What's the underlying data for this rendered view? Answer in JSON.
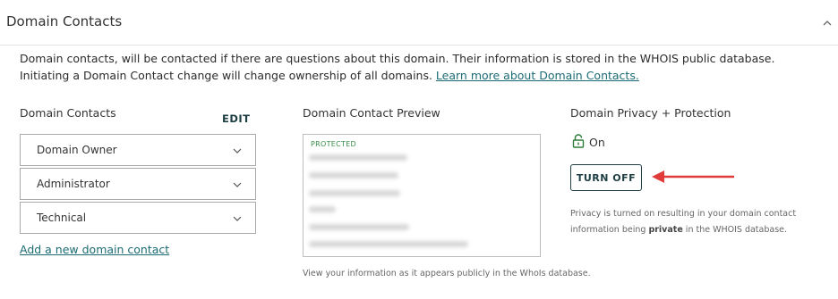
{
  "header": {
    "title": "Domain Contacts",
    "collapse_icon": "chevron-up-icon"
  },
  "intro": {
    "text": "Domain contacts, will be contacted if there are questions about this domain. Their information is stored in the WHOIS public database. Initiating a Domain Contact change will change ownership of all domains. ",
    "link": "Learn more about Domain Contacts."
  },
  "contacts": {
    "title": "Domain Contacts",
    "edit_label": "EDIT",
    "items": [
      {
        "label": "Domain Owner"
      },
      {
        "label": "Administrator"
      },
      {
        "label": "Technical"
      }
    ],
    "add_link": "Add a new domain contact"
  },
  "preview": {
    "title": "Domain Contact Preview",
    "badge": "PROTECTED",
    "caption": "View your information as it appears publicly in the WhoIs database."
  },
  "privacy": {
    "title": "Domain Privacy + Protection",
    "status": "On",
    "button_label": "TURN OFF",
    "note_before": "Privacy is turned on resulting in your domain contact information being ",
    "note_bold": "private",
    "note_after": " in the WHOIS database.",
    "accent_color": "#1d3e43",
    "arrow_color": "#e03c3c"
  }
}
